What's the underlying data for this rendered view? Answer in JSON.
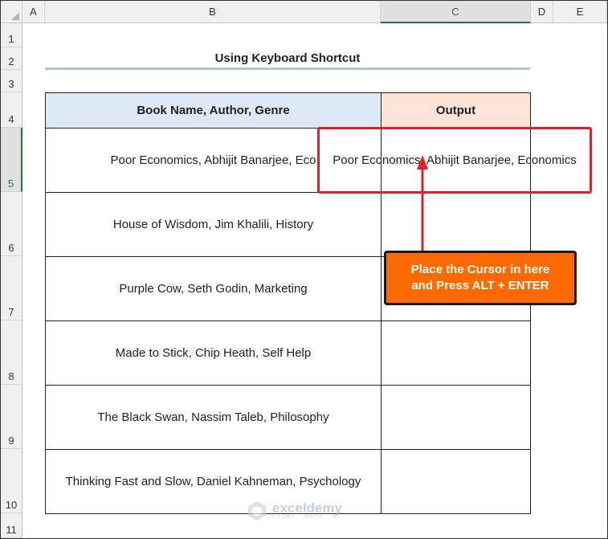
{
  "columns": [
    "A",
    "B",
    "C",
    "D",
    "E"
  ],
  "rows": [
    "1",
    "2",
    "3",
    "4",
    "5",
    "6",
    "7",
    "8",
    "9",
    "10",
    "11"
  ],
  "selected_column": "C",
  "selected_row": "5",
  "title": "Using Keyboard Shortcut",
  "table": {
    "headers": [
      "Book Name, Author, Genre",
      "Output"
    ],
    "rows": [
      [
        "Poor Economics, Abhijit Banarjee, Eco",
        "Poor Economics, Abhijit Banarjee, Economics"
      ],
      [
        "House of Wisdom, Jim Khalili, History",
        ""
      ],
      [
        "Purple Cow, Seth Godin, Marketing",
        ""
      ],
      [
        "Made to Stick, Chip Heath, Self Help",
        ""
      ],
      [
        "The Black Swan, Nassim Taleb, Philosophy",
        ""
      ],
      [
        "Thinking Fast and Slow, Daniel Kahneman, Psychology",
        ""
      ]
    ]
  },
  "callout": "Place the Cursor in here\nand Press ALT + ENTER",
  "watermark": {
    "name": "exceldemy",
    "tagline": "EXCEL · DATA · BI"
  },
  "colors": {
    "header_b": "#dde9f5",
    "header_c": "#fde4d7",
    "callout": "#ff6a00",
    "highlight": "#e0212c",
    "selection": "#217346"
  }
}
